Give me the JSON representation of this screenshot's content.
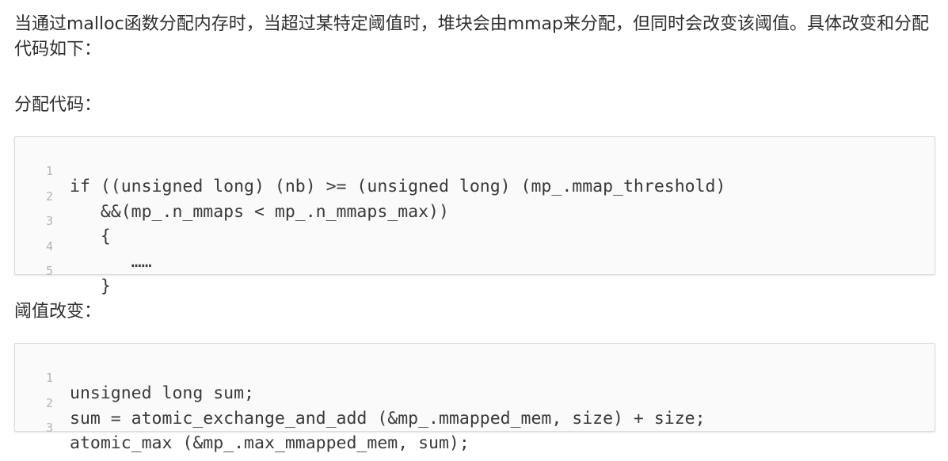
{
  "intro_text": "当通过malloc函数分配内存时，当超过某特定阈值时，堆块会由mmap来分配，但同时会改变该阈值。具体改变和分配代码如下：",
  "section1_label": "分配代码：",
  "code_block_1": {
    "lines": [
      {
        "num": "1",
        "code": "if ((unsigned long) (nb) >= (unsigned long) (mp_.mmap_threshold)"
      },
      {
        "num": "2",
        "code": "   &&(mp_.n_mmaps < mp_.n_mmaps_max))"
      },
      {
        "num": "3",
        "code": "   {"
      },
      {
        "num": "4",
        "code": "      ……"
      },
      {
        "num": "5",
        "code": "   }"
      }
    ]
  },
  "section2_label": "阈值改变：",
  "code_block_2": {
    "lines": [
      {
        "num": "1",
        "code": "unsigned long sum;"
      },
      {
        "num": "2",
        "code": "sum = atomic_exchange_and_add (&mp_.mmapped_mem, size) + size;"
      },
      {
        "num": "3",
        "code": "atomic_max (&mp_.max_mmapped_mem, sum);"
      }
    ]
  }
}
